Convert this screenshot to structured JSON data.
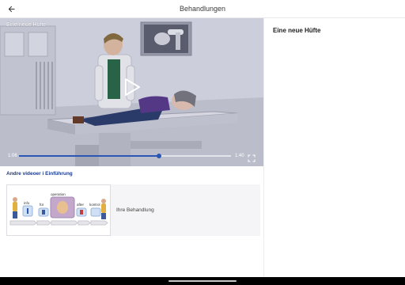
{
  "header": {
    "title": "Behandlungen",
    "back_icon": "arrow-left-icon"
  },
  "player": {
    "video_title": "Eine neue Hüfte",
    "current_time": "1:06",
    "duration": "1:40",
    "progress": 0.66,
    "play_icon": "play-icon",
    "fullscreen_icon": "fullscreen-icon",
    "accent_color": "#2a56b6"
  },
  "related": {
    "heading": "Andre videoer i Einführung",
    "items": [
      {
        "label": "Ihre Behandlung",
        "steps": [
          "info",
          "für",
          "operation",
          "after",
          "kontrol"
        ]
      }
    ]
  },
  "side_panel": {
    "title": "Eine neue Hüfte"
  }
}
